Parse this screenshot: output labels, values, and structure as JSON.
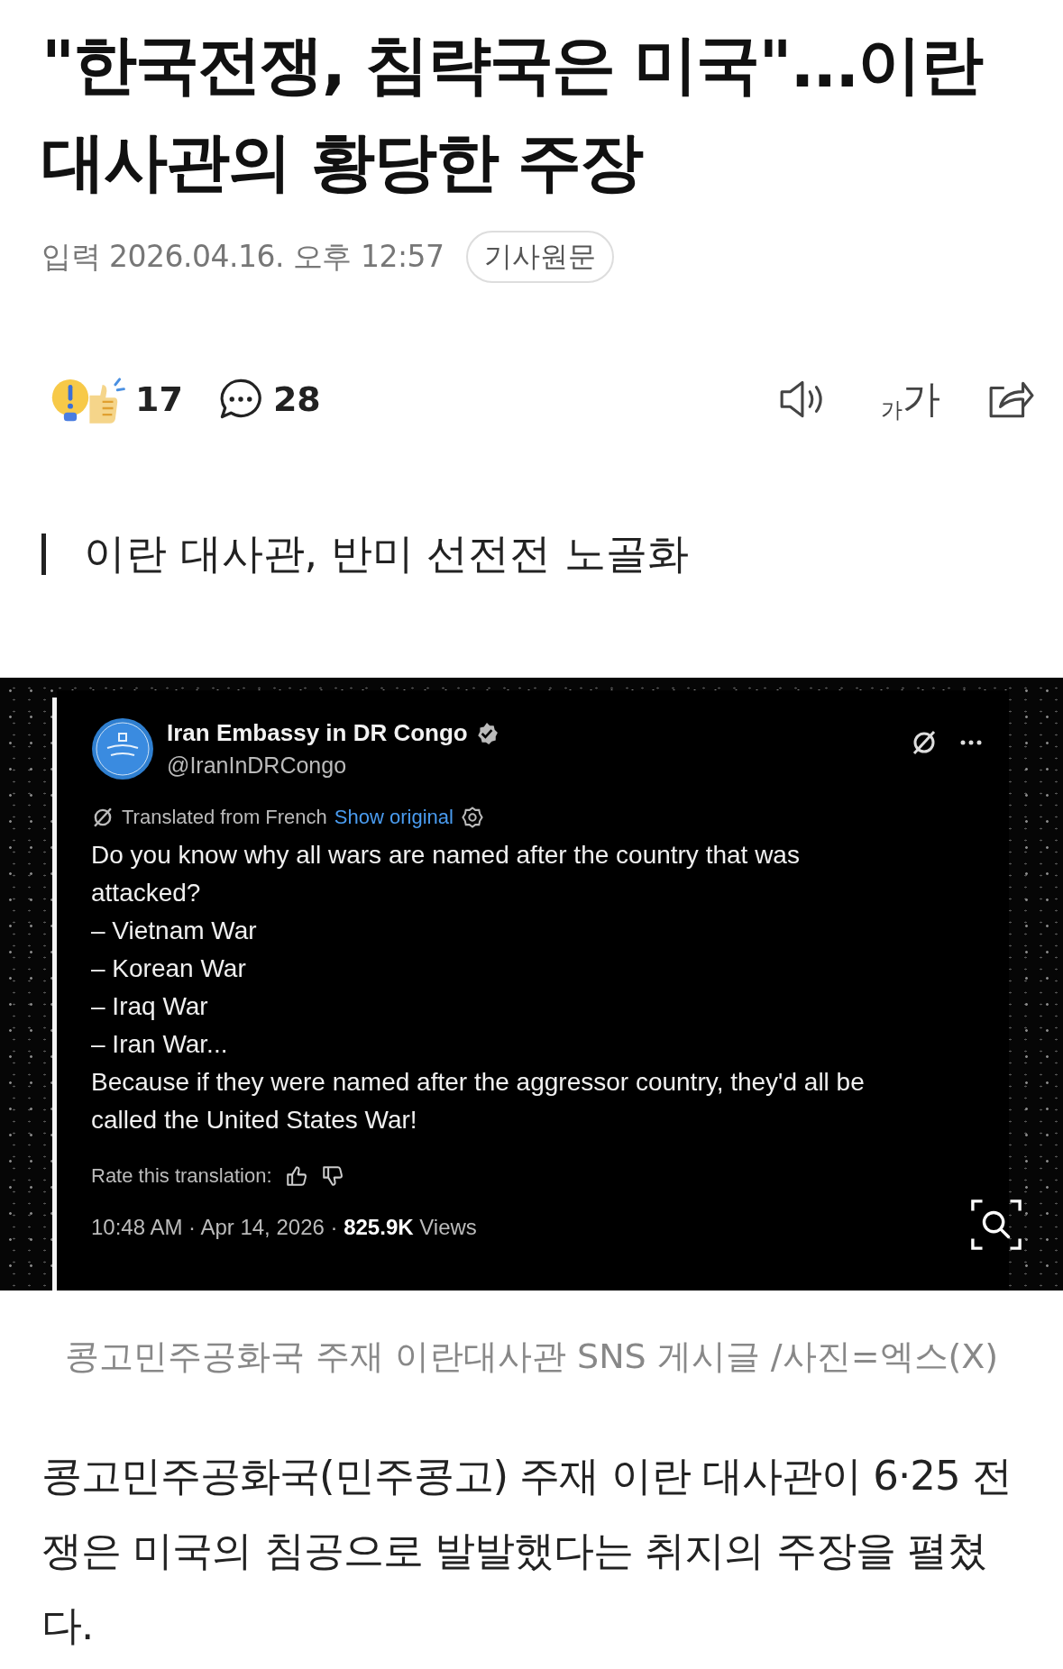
{
  "article": {
    "title": "\"한국전쟁, 침략국은 미국\"...이란 대사관의 황당한 주장",
    "published": "입력 2026.04.16. 오후 12:57",
    "original_link": "기사원문"
  },
  "reactions": {
    "count": "17",
    "comments": "28",
    "font_size": {
      "small": "가",
      "large": "가"
    }
  },
  "subheading": "이란 대사관, 반미 선전전 노골화",
  "tweet": {
    "name": "Iran Embassy in DR Congo",
    "handle": "@IranInDRCongo",
    "translated": "Translated from French",
    "show_original": "Show original",
    "lines": [
      "Do you know why all wars are named after the country that was attacked?",
      "– Vietnam War",
      "– Korean War",
      "– Iraq War",
      "– Iran War...",
      "Because if they were named after the aggressor country, they'd all be called the United States War!"
    ],
    "rate": "Rate this translation:",
    "footer": "10:48 AM · Apr 14, 2026 · **825.9K** Views"
  },
  "caption": "콩고민주공화국 주재 이란대사관 SNS 게시글 /사진=엑스(X)",
  "body": "콩고민주공화국(민주콩고) 주재 이란 대사관이 6·25 전쟁은 미국의 침공으로 발발했다는 취지의 주장을 펼쳤다."
}
